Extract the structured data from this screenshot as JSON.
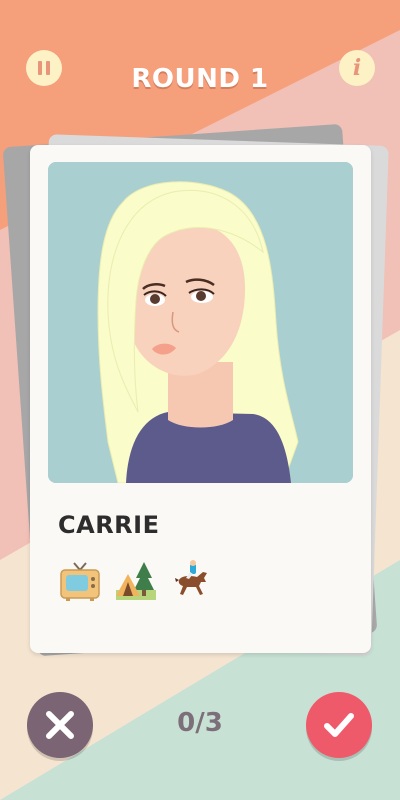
{
  "header": {
    "round_label": "ROUND 1",
    "pause_icon": "pause-icon",
    "info_icon": "info-icon"
  },
  "card": {
    "name": "CARRIE",
    "interests": [
      "tv-icon",
      "camping-icon",
      "horse-racing-icon"
    ]
  },
  "footer": {
    "score": "0/3",
    "reject_icon": "close-icon",
    "accept_icon": "check-icon"
  },
  "colors": {
    "background_top": "#f59f7b",
    "background_stripe_pink": "#f1c0b6",
    "background_stripe_cream": "#f4e4d0",
    "background_bottom": "#c7e1d5",
    "reject_button": "#7b6473",
    "accept_button": "#ee5a69",
    "portrait_background": "#aacfd0"
  }
}
